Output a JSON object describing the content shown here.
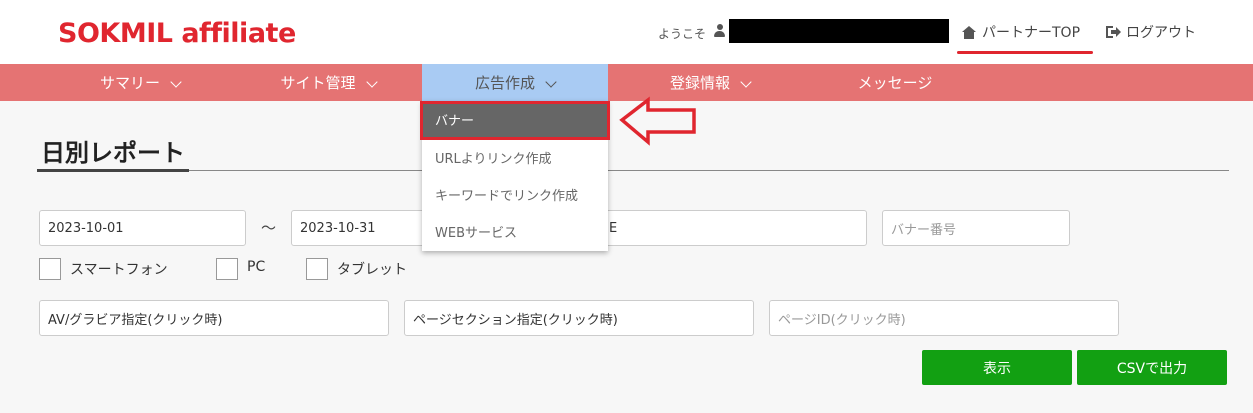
{
  "header": {
    "logo": "SOKMIL affiliate",
    "welcome": "ようこそ",
    "partner_top": "パートナーTOP",
    "logout": "ログアウト"
  },
  "nav": {
    "items": [
      {
        "label": "サマリー"
      },
      {
        "label": "サイト管理"
      },
      {
        "label": "広告作成"
      },
      {
        "label": "登録情報"
      },
      {
        "label": "メッセージ"
      }
    ],
    "active_index": 2
  },
  "dropdown": {
    "items": [
      {
        "label": "バナー"
      },
      {
        "label": "URLよりリンク作成"
      },
      {
        "label": "キーワードでリンク作成"
      },
      {
        "label": "WEBサービス"
      }
    ],
    "selected_index": 0
  },
  "page": {
    "title": "日別レポート"
  },
  "filters": {
    "date_from": "2023-10-01",
    "tilde": "～",
    "date_to": "2023-10-31",
    "partial_value": "E",
    "banner_no_placeholder": "バナー番号",
    "checkboxes": [
      {
        "label": "スマートフォン"
      },
      {
        "label": "PC"
      },
      {
        "label": "タブレット"
      }
    ],
    "av_gravure": "AV/グラビア指定(クリック時)",
    "page_section": "ページセクション指定(クリック時)",
    "page_id_placeholder": "ページID(クリック時)"
  },
  "buttons": {
    "show": "表示",
    "csv": "CSVで出力"
  },
  "colors": {
    "brand_red": "#e0262f",
    "nav_bg": "#e57373",
    "nav_active": "#a9cbf3",
    "button_green": "#12a012"
  }
}
